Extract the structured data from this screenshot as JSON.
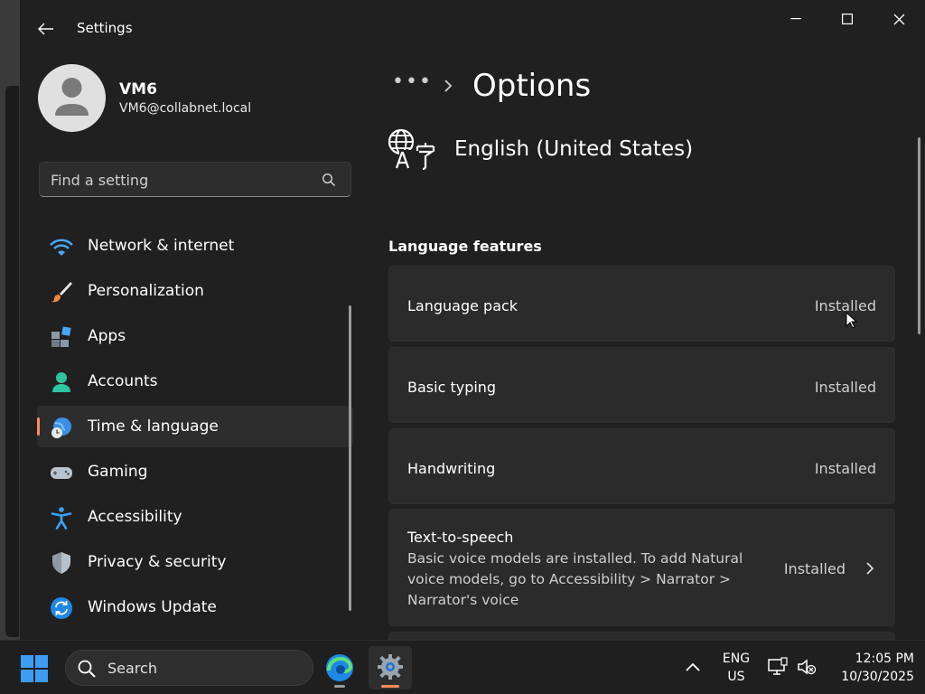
{
  "window": {
    "title": "Settings"
  },
  "profile": {
    "name": "VM6",
    "email": "VM6@collabnet.local"
  },
  "search": {
    "placeholder": "Find a setting"
  },
  "nav": [
    {
      "label": "Network & internet",
      "icon": "wifi-icon"
    },
    {
      "label": "Personalization",
      "icon": "brush-icon"
    },
    {
      "label": "Apps",
      "icon": "apps-icon"
    },
    {
      "label": "Accounts",
      "icon": "accounts-icon"
    },
    {
      "label": "Time & language",
      "icon": "globe-clock-icon",
      "active": true
    },
    {
      "label": "Gaming",
      "icon": "gamepad-icon"
    },
    {
      "label": "Accessibility",
      "icon": "accessibility-icon"
    },
    {
      "label": "Privacy & security",
      "icon": "shield-icon"
    },
    {
      "label": "Windows Update",
      "icon": "update-icon"
    }
  ],
  "breadcrumb": {
    "dots": "•••",
    "title": "Options"
  },
  "language": {
    "name": "English (United States)"
  },
  "features": {
    "title": "Language features",
    "items": [
      {
        "label": "Language pack",
        "status": "Installed"
      },
      {
        "label": "Basic typing",
        "status": "Installed"
      },
      {
        "label": "Handwriting",
        "status": "Installed"
      },
      {
        "label": "Text-to-speech",
        "description": "Basic voice models are installed. To add Natural voice models, go to Accessibility > Narrator > Narrator's voice",
        "status": "Installed"
      }
    ]
  },
  "taskbar": {
    "search_label": "Search",
    "lang_line1": "ENG",
    "lang_line2": "US",
    "time": "12:05 PM",
    "date": "10/30/2025"
  },
  "colors": {
    "accent": "#ff8a5b",
    "background": "#202020",
    "card": "#2b2b2b"
  }
}
